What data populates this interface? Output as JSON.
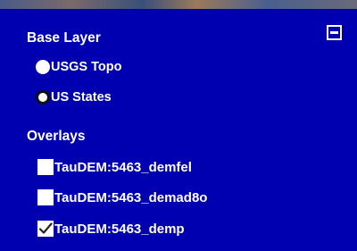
{
  "layer_control": {
    "base_layer_title": "Base Layer",
    "collapse_label": "",
    "base_layers": [
      {
        "label": "USGS Topo",
        "selected": false
      },
      {
        "label": "US States",
        "selected": true
      }
    ],
    "overlays_title": "Overlays",
    "overlays": [
      {
        "label": "TauDEM:5463_demfel",
        "checked": false
      },
      {
        "label": "TauDEM:5463_demad8o",
        "checked": false
      },
      {
        "label": "TauDEM:5463_demp",
        "checked": true
      }
    ]
  },
  "colors": {
    "panel_background": "#0000b0",
    "text": "#ffffff"
  }
}
